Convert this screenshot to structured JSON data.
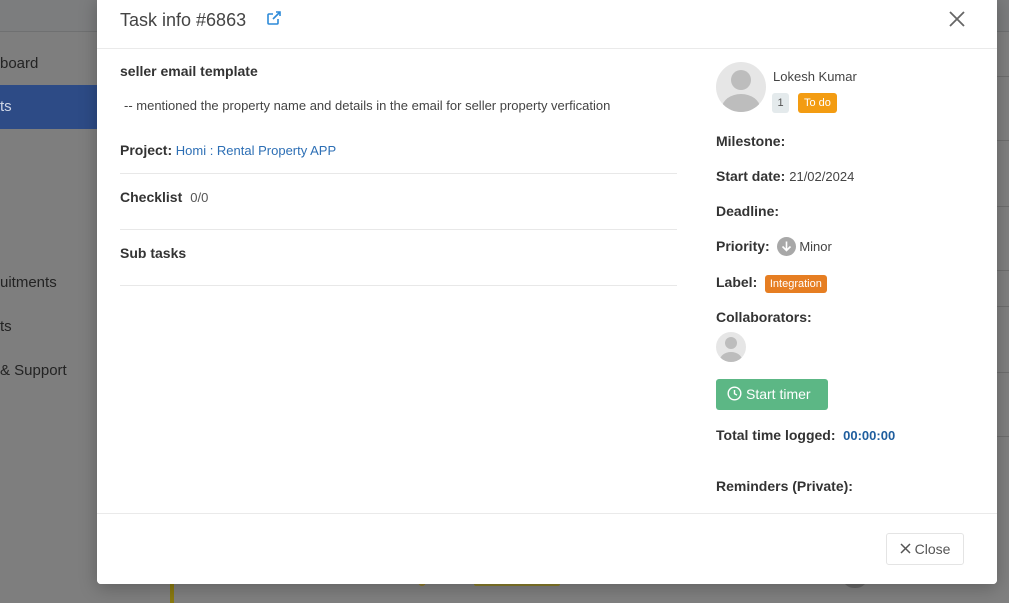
{
  "background": {
    "sidebar_items": [
      {
        "label": "board",
        "active": false
      },
      {
        "label": "ts",
        "active": true
      },
      {
        "label": "uitments",
        "active": false
      },
      {
        "label": "ts",
        "active": false
      },
      {
        "label": "& Support",
        "active": false
      }
    ]
  },
  "modal": {
    "title": "Task info #6863",
    "close_icon": "close-icon",
    "external_link_icon": "external-link-icon"
  },
  "task": {
    "title": "seller email template",
    "description": "-- mentioned the property name and details in the email for seller property verfication",
    "project_label": "Project:",
    "project_value": "Homi : Rental Property APP",
    "checklist_label": "Checklist",
    "checklist_value": "0/0",
    "subtasks_label": "Sub tasks"
  },
  "details": {
    "assignee_name": "Lokesh Kumar",
    "count_badge": "1",
    "status_badge": "To do",
    "milestone_label": "Milestone:",
    "milestone_value": "",
    "start_date_label": "Start date:",
    "start_date_value": "21/02/2024",
    "deadline_label": "Deadline:",
    "deadline_value": "",
    "priority_label": "Priority:",
    "priority_value": "Minor",
    "label_label": "Label:",
    "label_value": "Integration",
    "collaborators_label": "Collaborators:",
    "start_timer_label": "Start timer",
    "total_time_label": "Total time logged:",
    "total_time_value": "00:00:00",
    "reminders_label": "Reminders (Private):"
  },
  "footer": {
    "close_label": "Close"
  },
  "colors": {
    "status_badge": "#f39c12",
    "label_badge": "#e67e22",
    "timer_button": "#5cb785",
    "link": "#2d6fb5",
    "time_value": "#1f5e9e"
  }
}
